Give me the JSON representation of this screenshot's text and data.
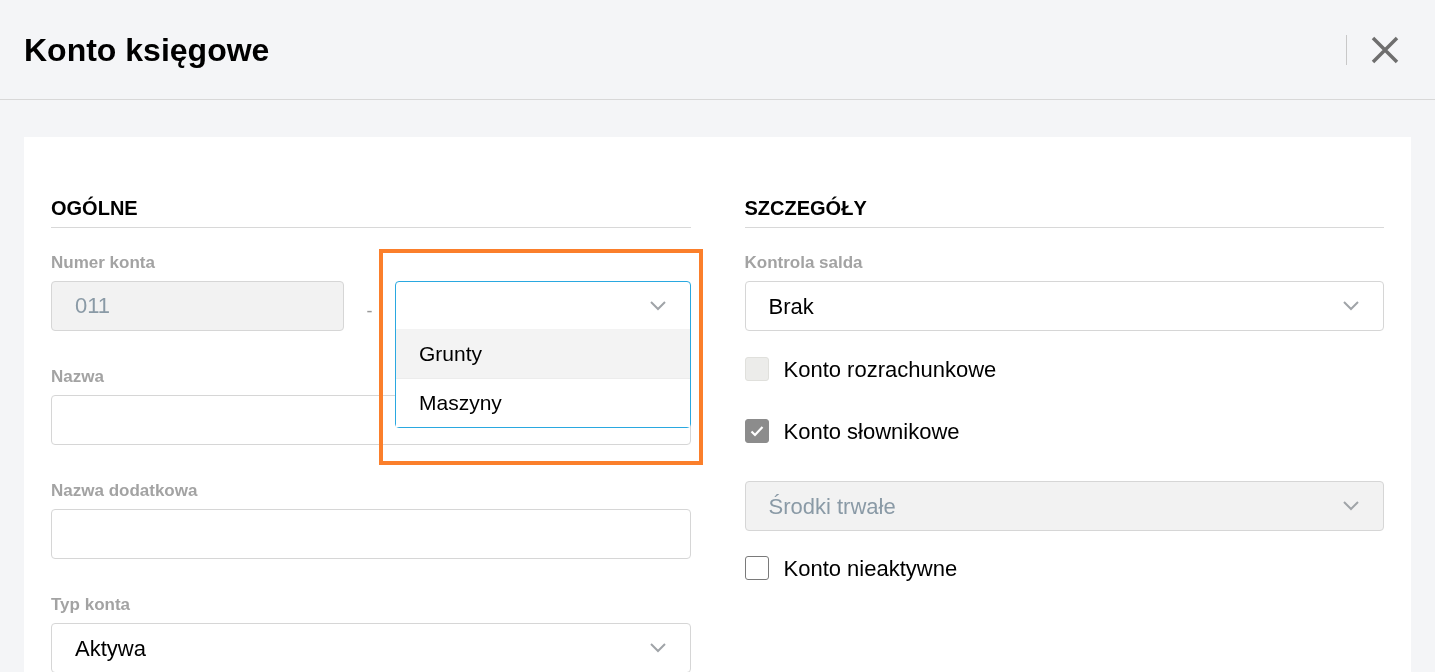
{
  "window": {
    "title": "Konto księgowe"
  },
  "general": {
    "heading": "OGÓLNE",
    "account_number": {
      "label": "Numer konta",
      "value": "011",
      "separator": "-",
      "suffix_dropdown": {
        "expanded": true,
        "options": [
          {
            "label": "Grunty",
            "selected": true
          },
          {
            "label": "Maszyny",
            "selected": false
          }
        ]
      }
    },
    "name": {
      "label": "Nazwa"
    },
    "extra_name": {
      "label": "Nazwa dodatkowa"
    },
    "account_type": {
      "label": "Typ konta",
      "value": "Aktywa"
    }
  },
  "details": {
    "heading": "SZCZEGÓŁY",
    "balance_control": {
      "label": "Kontrola salda",
      "value": "Brak"
    },
    "items": [
      {
        "kind": "checkbox",
        "label": "Konto rozrachunkowe",
        "checked": false,
        "disabled": true
      },
      {
        "kind": "checkbox",
        "label": "Konto słownikowe",
        "checked": true,
        "disabled": true
      },
      {
        "kind": "select",
        "value": "Środki trwałe",
        "disabled": true
      },
      {
        "kind": "checkbox",
        "label": "Konto nieaktywne",
        "checked": false,
        "disabled": false
      }
    ]
  }
}
